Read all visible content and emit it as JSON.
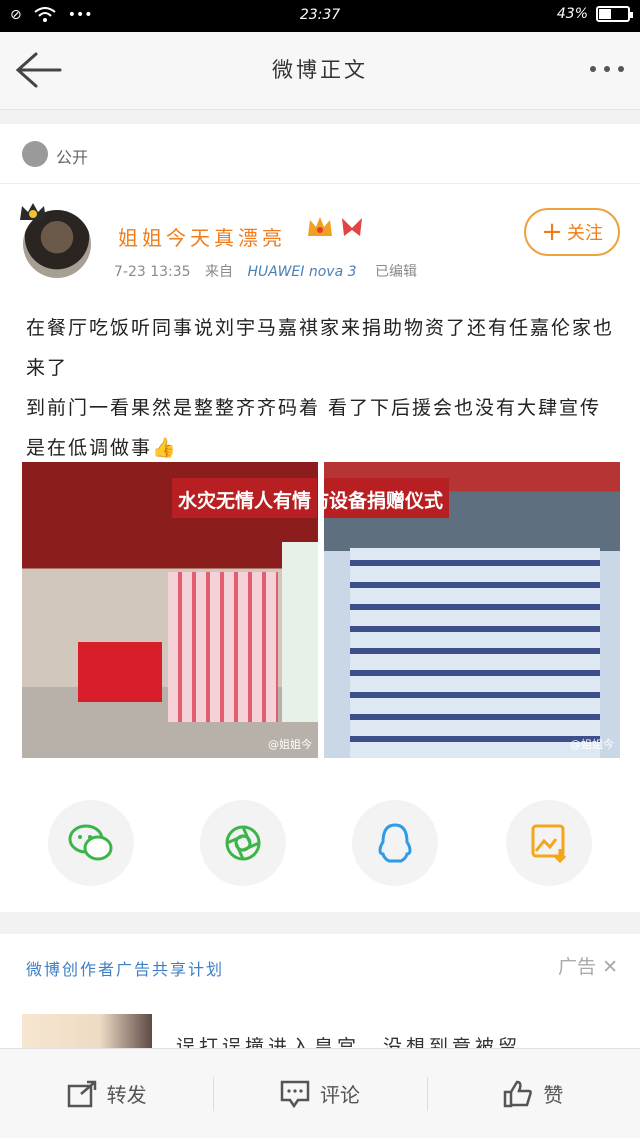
{
  "status_bar": {
    "time": "23:37",
    "battery": "43%",
    "battery_level": 0.43
  },
  "nav": {
    "title": "微博正文"
  },
  "visibility": {
    "label": "公开"
  },
  "post": {
    "username": "姐姐今天真漂亮",
    "time": "7-23 13:35",
    "source_prefix": "来自",
    "source": "HUAWEI nova 3",
    "edited": "已编辑",
    "follow_label": "关注",
    "text_line1": "在餐厅吃饭听同事说刘宇马嘉祺家来捐助物资了还有任嘉伦家也来了",
    "text_line2": "到前门一看果然是整整齐齐码着 看了下后援会也没有大肆宣传 是在低调做事👍",
    "image1_banner": "水灾无情人有情",
    "image2_banner": "防设备捐赠仪式",
    "watermark": "@姐姐今"
  },
  "share": {
    "icons": [
      "wechat-icon",
      "moments-icon",
      "qq-icon",
      "save-image-icon"
    ],
    "colors": {
      "wechat": "#3bb54a",
      "moments": "#3bb54a",
      "qq": "#2f9be8",
      "save": "#f3a51b"
    }
  },
  "ad": {
    "plan_label": "微博创作者广告共享计划",
    "ad_label": "广告",
    "text": "误打误撞进入皇宫，没想到竟被留"
  },
  "actions": {
    "repost": "转发",
    "comment": "评论",
    "like": "赞"
  }
}
